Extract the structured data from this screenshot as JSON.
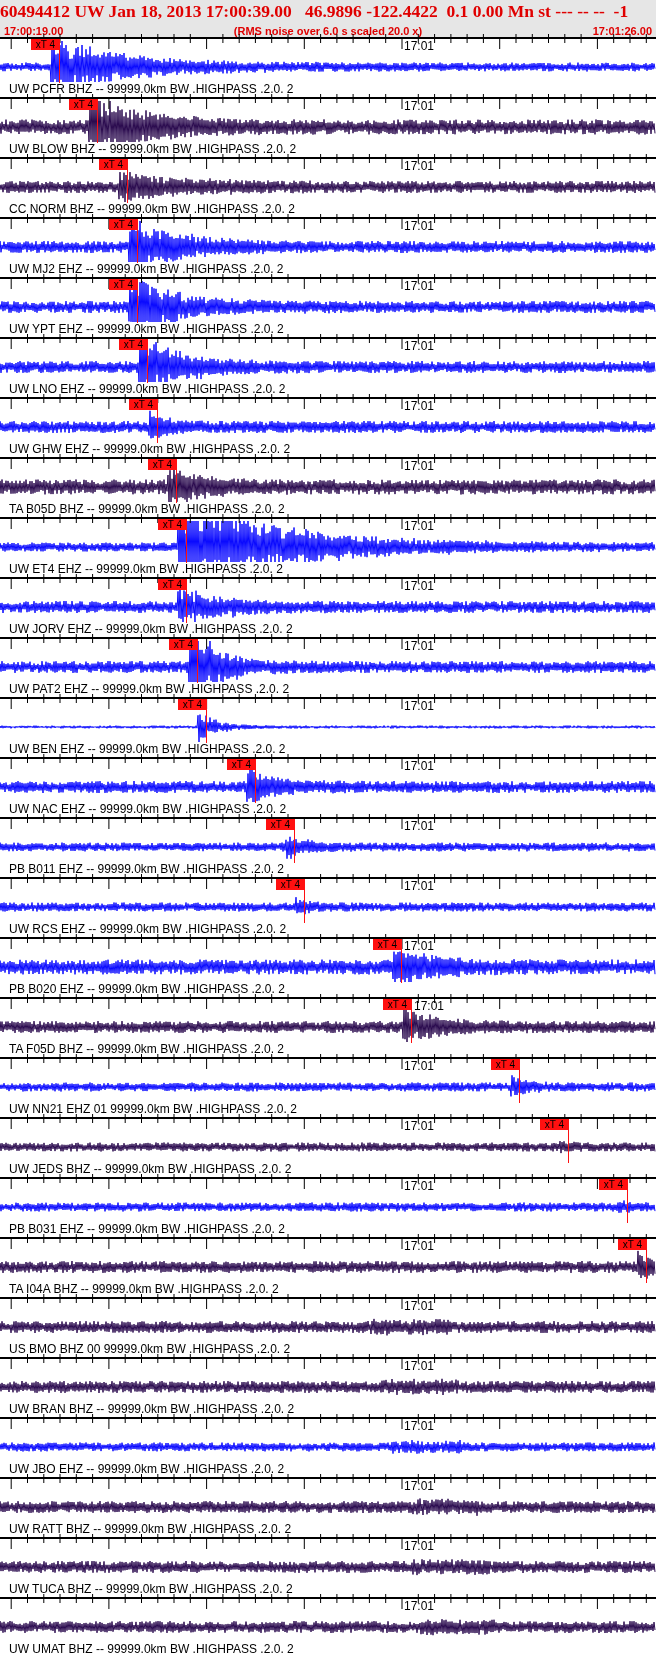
{
  "header": {
    "title": "60494412 UW Jan 18, 2013 17:00:39.00   46.9896 -122.4422  0.1 0.00 Mn st --- -- --  -1",
    "start_time": "17:00:19.00",
    "note": "(RMS noise over 6.0 s scaled 20.0 x)",
    "end_time": "17:01:26.00"
  },
  "traces": [
    {
      "label": "UW PCFR BHZ -- 99999.0km BW .HIGHPASS .2.0. 2",
      "time_mark": "17:01",
      "color": "#0a0aff",
      "pick": "xT 4"
    },
    {
      "label": "UW BLOW BHZ -- 99999.0km BW .HIGHPASS .2.0. 2",
      "time_mark": "17:01",
      "color": "#2b0b4f",
      "pick": "xT 4"
    },
    {
      "label": "CC NORM BHZ -- 99999.0km BW .HIGHPASS .2.0. 2",
      "time_mark": "17:01",
      "color": "#2b0b4f",
      "pick": "xT 4"
    },
    {
      "label": "UW MJ2 EHZ -- 99999.0km BW .HIGHPASS .2.0. 2",
      "time_mark": "17:01",
      "color": "#0a0aff",
      "pick": "xT 4"
    },
    {
      "label": "UW YPT EHZ -- 99999.0km BW .HIGHPASS .2.0. 2",
      "time_mark": "17:01",
      "color": "#0a0aff",
      "pick": "xT 4"
    },
    {
      "label": "UW LNO EHZ -- 99999.0km BW .HIGHPASS .2.0. 2",
      "time_mark": "17:01",
      "color": "#0a0aff",
      "pick": "xT 4"
    },
    {
      "label": "UW GHW EHZ -- 99999.0km BW .HIGHPASS .2.0. 2",
      "time_mark": "17:01",
      "color": "#0a0aff",
      "pick": "xT 4"
    },
    {
      "label": "TA B05D BHZ -- 99999.0km BW .HIGHPASS .2.0. 2",
      "time_mark": "17:01",
      "color": "#2b0b4f",
      "pick": "xT 4"
    },
    {
      "label": "UW ET4 EHZ -- 99999.0km BW .HIGHPASS .2.0. 2",
      "time_mark": "17:01",
      "color": "#0a0aff",
      "pick": "xT 4"
    },
    {
      "label": "UW JORV EHZ -- 99999.0km BW .HIGHPASS .2.0. 2",
      "time_mark": "17:01",
      "color": "#0a0aff",
      "pick": "xT 4"
    },
    {
      "label": "UW PAT2 EHZ -- 99999.0km BW .HIGHPASS .2.0. 2",
      "time_mark": "17:01",
      "color": "#0a0aff",
      "pick": "xT 4"
    },
    {
      "label": "UW BEN EHZ -- 99999.0km BW .HIGHPASS .2.0. 2",
      "time_mark": "17:01",
      "color": "#0a0aff",
      "pick": "xT 4"
    },
    {
      "label": "UW NAC EHZ -- 99999.0km BW .HIGHPASS .2.0. 2",
      "time_mark": "17:01",
      "color": "#0a0aff",
      "pick": "xT 4"
    },
    {
      "label": "PB B011 EHZ -- 99999.0km BW .HIGHPASS .2.0. 2",
      "time_mark": "17:01",
      "color": "#0a0aff",
      "pick": "xT 4"
    },
    {
      "label": "UW RCS EHZ -- 99999.0km BW .HIGHPASS .2.0. 2",
      "time_mark": "17:01",
      "color": "#0a0aff",
      "pick": "xT 4"
    },
    {
      "label": "PB B020 EHZ -- 99999.0km BW .HIGHPASS .2.0. 2",
      "time_mark": "17:01",
      "color": "#0a0aff",
      "pick": "xT 4"
    },
    {
      "label": "TA F05D BHZ -- 99999.0km BW .HIGHPASS .2.0. 2",
      "time_mark": "17:01",
      "color": "#2b0b4f",
      "pick": "xT 4"
    },
    {
      "label": "UW NN21 EHZ 01 99999.0km BW .HIGHPASS .2.0. 2",
      "time_mark": "17:01",
      "color": "#0a0aff",
      "pick": "xT 4"
    },
    {
      "label": "UW JEDS BHZ -- 99999.0km BW .HIGHPASS .2.0. 2",
      "time_mark": "17:01",
      "color": "#2b0b4f",
      "pick": "xT 4"
    },
    {
      "label": "PB B031 EHZ -- 99999.0km BW .HIGHPASS .2.0. 2",
      "time_mark": "17:01",
      "color": "#0a0aff",
      "pick": "xT 4"
    },
    {
      "label": "TA I04A BHZ -- 99999.0km BW .HIGHPASS .2.0. 2",
      "time_mark": "17:01",
      "color": "#2b0b4f",
      "pick": "xT 4"
    },
    {
      "label": "US BMO BHZ 00 99999.0km BW .HIGHPASS .2.0. 2",
      "time_mark": "17:01",
      "color": "#2b0b4f"
    },
    {
      "label": "UW BRAN BHZ -- 99999.0km BW .HIGHPASS .2.0. 2",
      "time_mark": "17:01",
      "color": "#2b0b4f"
    },
    {
      "label": "UW JBO EHZ -- 99999.0km BW .HIGHPASS .2.0. 2",
      "time_mark": "17:01",
      "color": "#0a0aff"
    },
    {
      "label": "UW RATT BHZ -- 99999.0km BW .HIGHPASS .2.0. 2",
      "time_mark": "17:01",
      "color": "#2b0b4f"
    },
    {
      "label": "UW TUCA BHZ -- 99999.0km BW .HIGHPASS .2.0. 2",
      "time_mark": "17:01",
      "color": "#2b0b4f"
    },
    {
      "label": "UW UMAT BHZ -- 99999.0km BW .HIGHPASS .2.0. 2",
      "time_mark": "17:01",
      "color": "#2b0b4f"
    }
  ]
}
